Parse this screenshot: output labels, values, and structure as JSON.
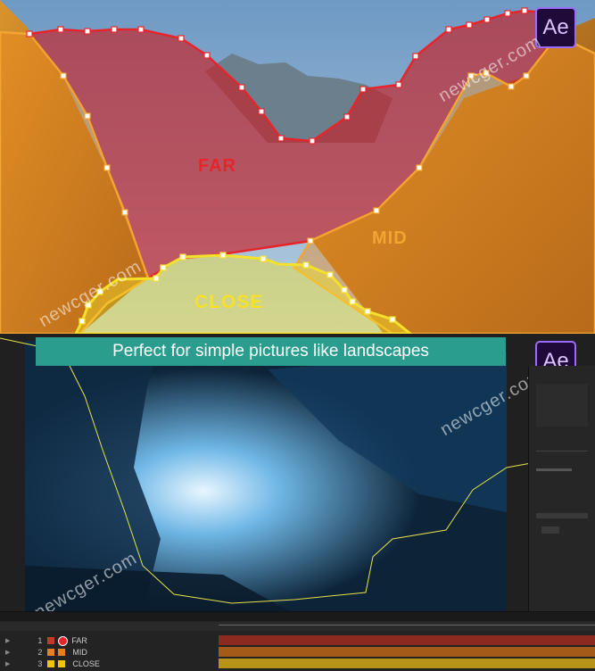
{
  "top": {
    "labels": {
      "far": "FAR",
      "mid": "MID",
      "close": "CLOSE"
    },
    "logo": "Ae",
    "watermark": "newcger.com",
    "colors": {
      "far": "#e8242b",
      "mid": "#f2a531",
      "close": "#f5e12a"
    }
  },
  "bottom": {
    "caption": "Perfect for simple pictures like landscapes",
    "logo": "Ae",
    "watermark": "newcger.com"
  },
  "timeline": {
    "layers": [
      {
        "num": "1",
        "name": "FAR",
        "color": "#c0392b"
      },
      {
        "num": "2",
        "name": "MID",
        "color": "#e67e22"
      },
      {
        "num": "3",
        "name": "CLOSE",
        "color": "#f1c40f"
      }
    ]
  }
}
